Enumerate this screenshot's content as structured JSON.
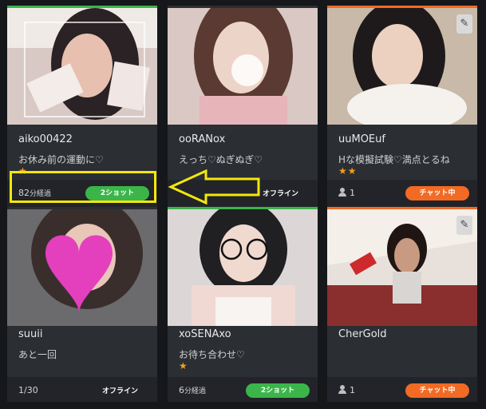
{
  "colors": {
    "accent_green": "#3bb54a",
    "accent_orange": "#f26a24",
    "star": "#f29e1c",
    "highlight": "#f2e80c"
  },
  "cards": [
    {
      "name": "aiko00422",
      "comment": "お休み前の運動に♡",
      "stars": "★",
      "footer_value": "82",
      "footer_unit": "分経過",
      "status": "2ショット",
      "status_type": "green",
      "accent": "green",
      "icon": ""
    },
    {
      "name": "ooRANox",
      "comment": "えっち♡ぬぎぬぎ♡",
      "stars": "",
      "footer_value": "",
      "footer_unit": "",
      "status": "オフライン",
      "status_type": "offline",
      "accent": "none",
      "icon": ""
    },
    {
      "name": "uuMOEuf",
      "comment": "Hな模擬試験♡満点とるね",
      "stars": "★★",
      "footer_value": "1",
      "footer_unit": "",
      "status": "チャット中",
      "status_type": "orange",
      "accent": "orange",
      "icon": "pen-icon"
    },
    {
      "name": "suuii",
      "comment": "あと一回",
      "stars": "",
      "footer_value": "1/30",
      "footer_unit": "",
      "status": "オフライン",
      "status_type": "offline",
      "accent": "none",
      "icon": ""
    },
    {
      "name": "xoSENAxo",
      "comment": "お待ち合わせ♡",
      "stars": "★",
      "footer_value": "6",
      "footer_unit": "分経過",
      "status": "2ショット",
      "status_type": "green",
      "accent": "green",
      "icon": ""
    },
    {
      "name": "CherGold",
      "comment": "",
      "stars": "",
      "footer_value": "1",
      "footer_unit": "",
      "status": "チャット中",
      "status_type": "orange",
      "accent": "orange",
      "icon": "pen-icon"
    }
  ]
}
